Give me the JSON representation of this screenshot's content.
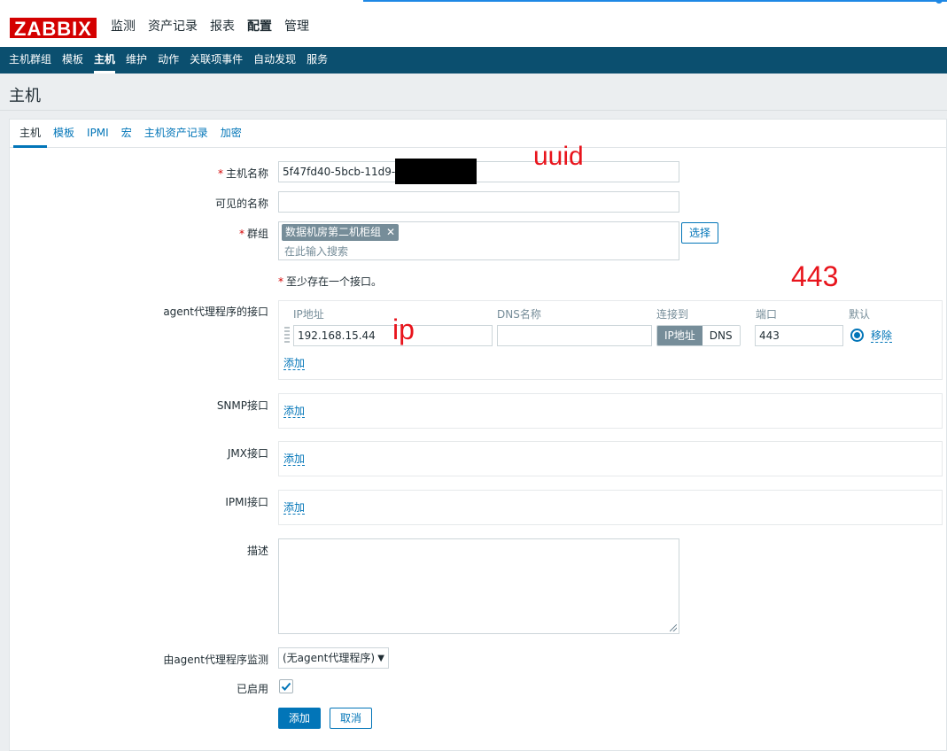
{
  "app": {
    "logo": "ZABBIX"
  },
  "main_menu": [
    {
      "label": "监测"
    },
    {
      "label": "资产记录"
    },
    {
      "label": "报表"
    },
    {
      "label": "配置",
      "selected": true
    },
    {
      "label": "管理"
    }
  ],
  "sub_nav": [
    {
      "label": "主机群组"
    },
    {
      "label": "模板"
    },
    {
      "label": "主机",
      "selected": true
    },
    {
      "label": "维护"
    },
    {
      "label": "动作"
    },
    {
      "label": "关联项事件"
    },
    {
      "label": "自动发现"
    },
    {
      "label": "服务"
    }
  ],
  "page": {
    "title": "主机"
  },
  "tabs": [
    {
      "label": "主机",
      "selected": true
    },
    {
      "label": "模板"
    },
    {
      "label": "IPMI"
    },
    {
      "label": "宏"
    },
    {
      "label": "主机资产记录"
    },
    {
      "label": "加密"
    }
  ],
  "form": {
    "host_name_label": "主机名称",
    "host_name_value": "5f47fd40-5bcb-11d9-a905",
    "visible_name_label": "可见的名称",
    "visible_name_value": "",
    "groups_label": "群组",
    "group_chip": "数据机房第二机柜组",
    "groups_placeholder": "在此输入搜索",
    "select_button": "选择",
    "interface_note": "至少存在一个接口。",
    "agent_label": "agent代理程序的接口",
    "snmp_label": "SNMP接口",
    "jmx_label": "JMX接口",
    "ipmi_label": "IPMI接口",
    "description_label": "描述",
    "proxy_label": "由agent代理程序监测",
    "proxy_value": "(无agent代理程序)",
    "enabled_label": "已启用",
    "enabled": true,
    "add_button": "添加",
    "cancel_button": "取消"
  },
  "interface": {
    "headers": {
      "ip": "IP地址",
      "dns": "DNS名称",
      "connect": "连接到",
      "port": "端口",
      "default": "默认"
    },
    "ip_value": "192.168.15.44",
    "dns_value": "",
    "connect_ip": "IP地址",
    "connect_dns": "DNS",
    "port_value": "443",
    "remove_link": "移除",
    "add_link": "添加"
  },
  "annotations": {
    "uuid": "uuid",
    "port": "443",
    "ip": "ip",
    "color": "#e8141c"
  },
  "colors": {
    "brand": "#d40000",
    "nav": "#0b4f6f",
    "link": "#0275b8"
  }
}
